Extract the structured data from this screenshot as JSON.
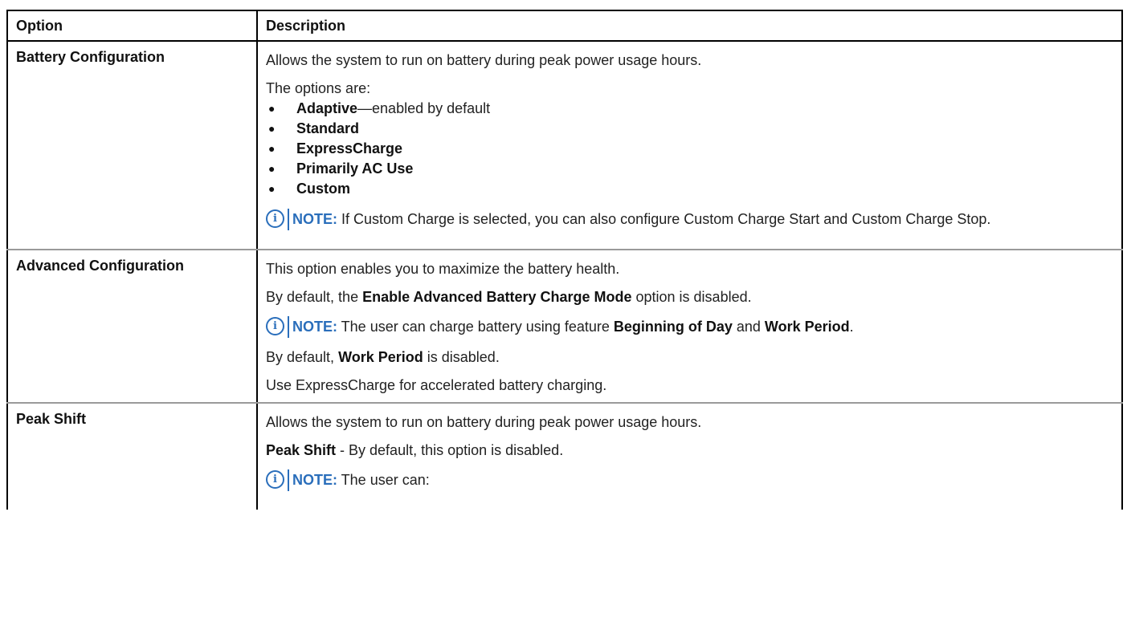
{
  "table": {
    "headers": {
      "option": "Option",
      "description": "Description"
    },
    "rows": [
      {
        "option": "Battery Configuration",
        "intro": "Allows the system to run on battery during peak power usage hours.",
        "options_label": "The options are:",
        "options": [
          {
            "bold": "Adaptive",
            "rest": "—enabled by default"
          },
          {
            "bold": "Standard",
            "rest": ""
          },
          {
            "bold": "ExpressCharge",
            "rest": ""
          },
          {
            "bold": "Primarily AC Use",
            "rest": ""
          },
          {
            "bold": "Custom",
            "rest": ""
          }
        ],
        "note": {
          "label": "NOTE:",
          "text": " If Custom Charge is selected, you can also configure Custom Charge Start and Custom Charge Stop."
        }
      },
      {
        "option": "Advanced Configuration",
        "line1": "This option enables you to maximize the battery health.",
        "line2": {
          "pre": "By default, the ",
          "bold": "Enable Advanced Battery Charge Mode",
          "post": " option is disabled."
        },
        "note": {
          "label": "NOTE:",
          "pre": " The user can charge battery using feature ",
          "bold1": "Beginning of Day",
          "mid": " and ",
          "bold2": "Work Period",
          "post": "."
        },
        "line3": {
          "pre": "By default, ",
          "bold": "Work Period",
          "post": " is disabled."
        },
        "line4": "Use ExpressCharge for accelerated battery charging."
      },
      {
        "option": "Peak Shift",
        "line1": "Allows the system to run on battery during peak power usage hours.",
        "line2": {
          "bold": "Peak Shift",
          "post": " - By default, this option is disabled."
        },
        "note": {
          "label": "NOTE:",
          "text": " The user can:"
        }
      }
    ]
  },
  "icons": {
    "note": "info-icon",
    "note_glyph": "i"
  },
  "colors": {
    "note_blue": "#2a6ebb",
    "border": "#000000",
    "row_divider": "#9a9a9a"
  }
}
